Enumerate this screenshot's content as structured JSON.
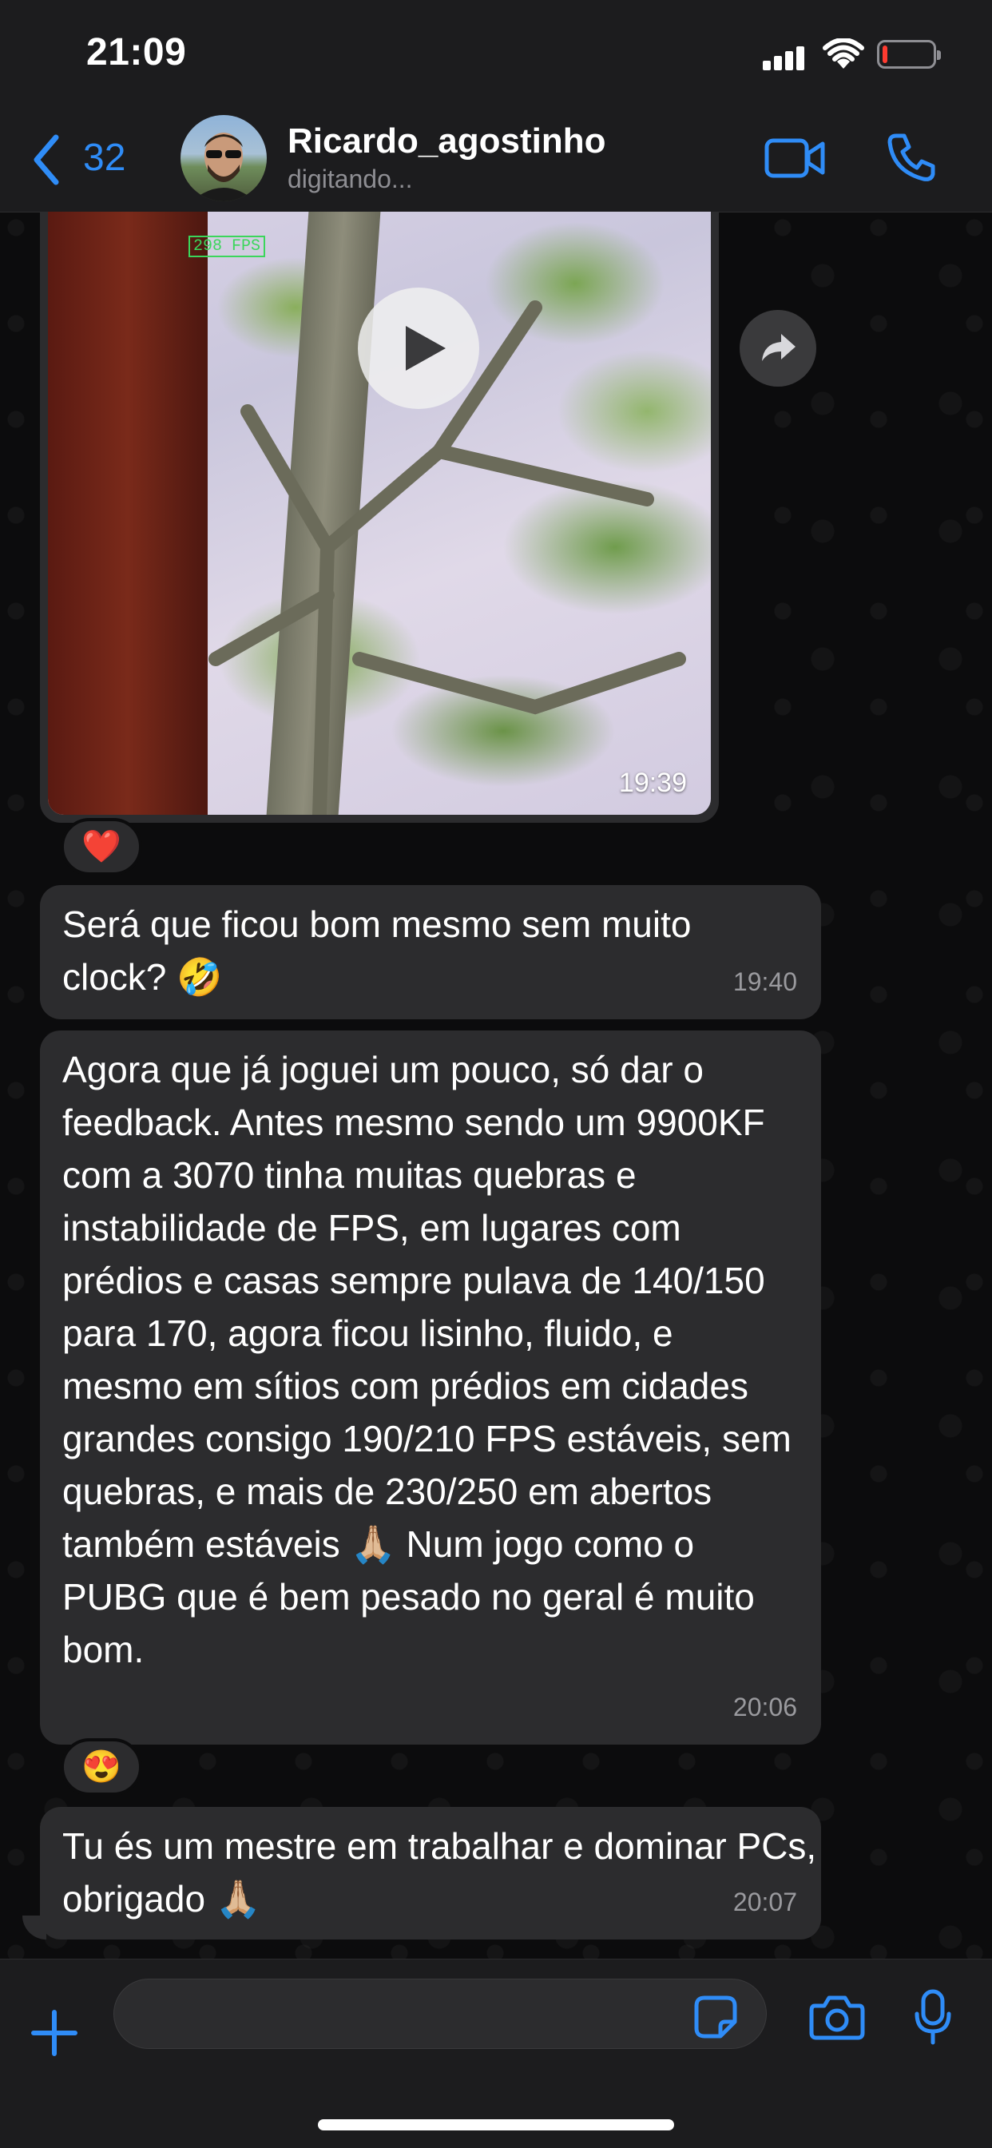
{
  "status_bar": {
    "time": "21:09"
  },
  "header": {
    "back_count": "32",
    "contact_name": "Ricardo_agostinho",
    "contact_status": "digitando..."
  },
  "messages": [
    {
      "type": "video",
      "time": "19:39",
      "overlay_text": "298 FPS",
      "reaction": "❤️"
    },
    {
      "type": "text",
      "text": "Será que ficou bom mesmo sem muito clock? 🤣",
      "time": "19:40"
    },
    {
      "type": "text",
      "text": "Agora que já joguei um pouco, só dar o feedback. Antes mesmo sendo um 9900KF com a 3070 tinha muitas quebras e instabilidade de FPS, em lugares com prédios e casas sempre pulava de 140/150 para 170, agora ficou lisinho, fluido, e mesmo em sítios com prédios em cidades grandes consigo 190/210 FPS estáveis, sem quebras, e mais de 230/250 em abertos também estáveis 🙏🏼 Num jogo como o PUBG que é bem pesado no geral é muito bom.",
      "time": "20:06",
      "reaction": "😍"
    },
    {
      "type": "text",
      "text": "Tu és um mestre em trabalhar e dominar PCs, obrigado 🙏🏼",
      "time": "20:07"
    }
  ],
  "input": {
    "value": ""
  },
  "colors": {
    "accent": "#2f8cf7",
    "bubble": "#2c2c2e",
    "battery_low": "#ff3b30"
  },
  "icons": [
    "back-chevron-icon",
    "video-call-icon",
    "phone-icon",
    "play-icon",
    "forward-icon",
    "plus-icon",
    "sticker-icon",
    "camera-icon",
    "microphone-icon"
  ]
}
